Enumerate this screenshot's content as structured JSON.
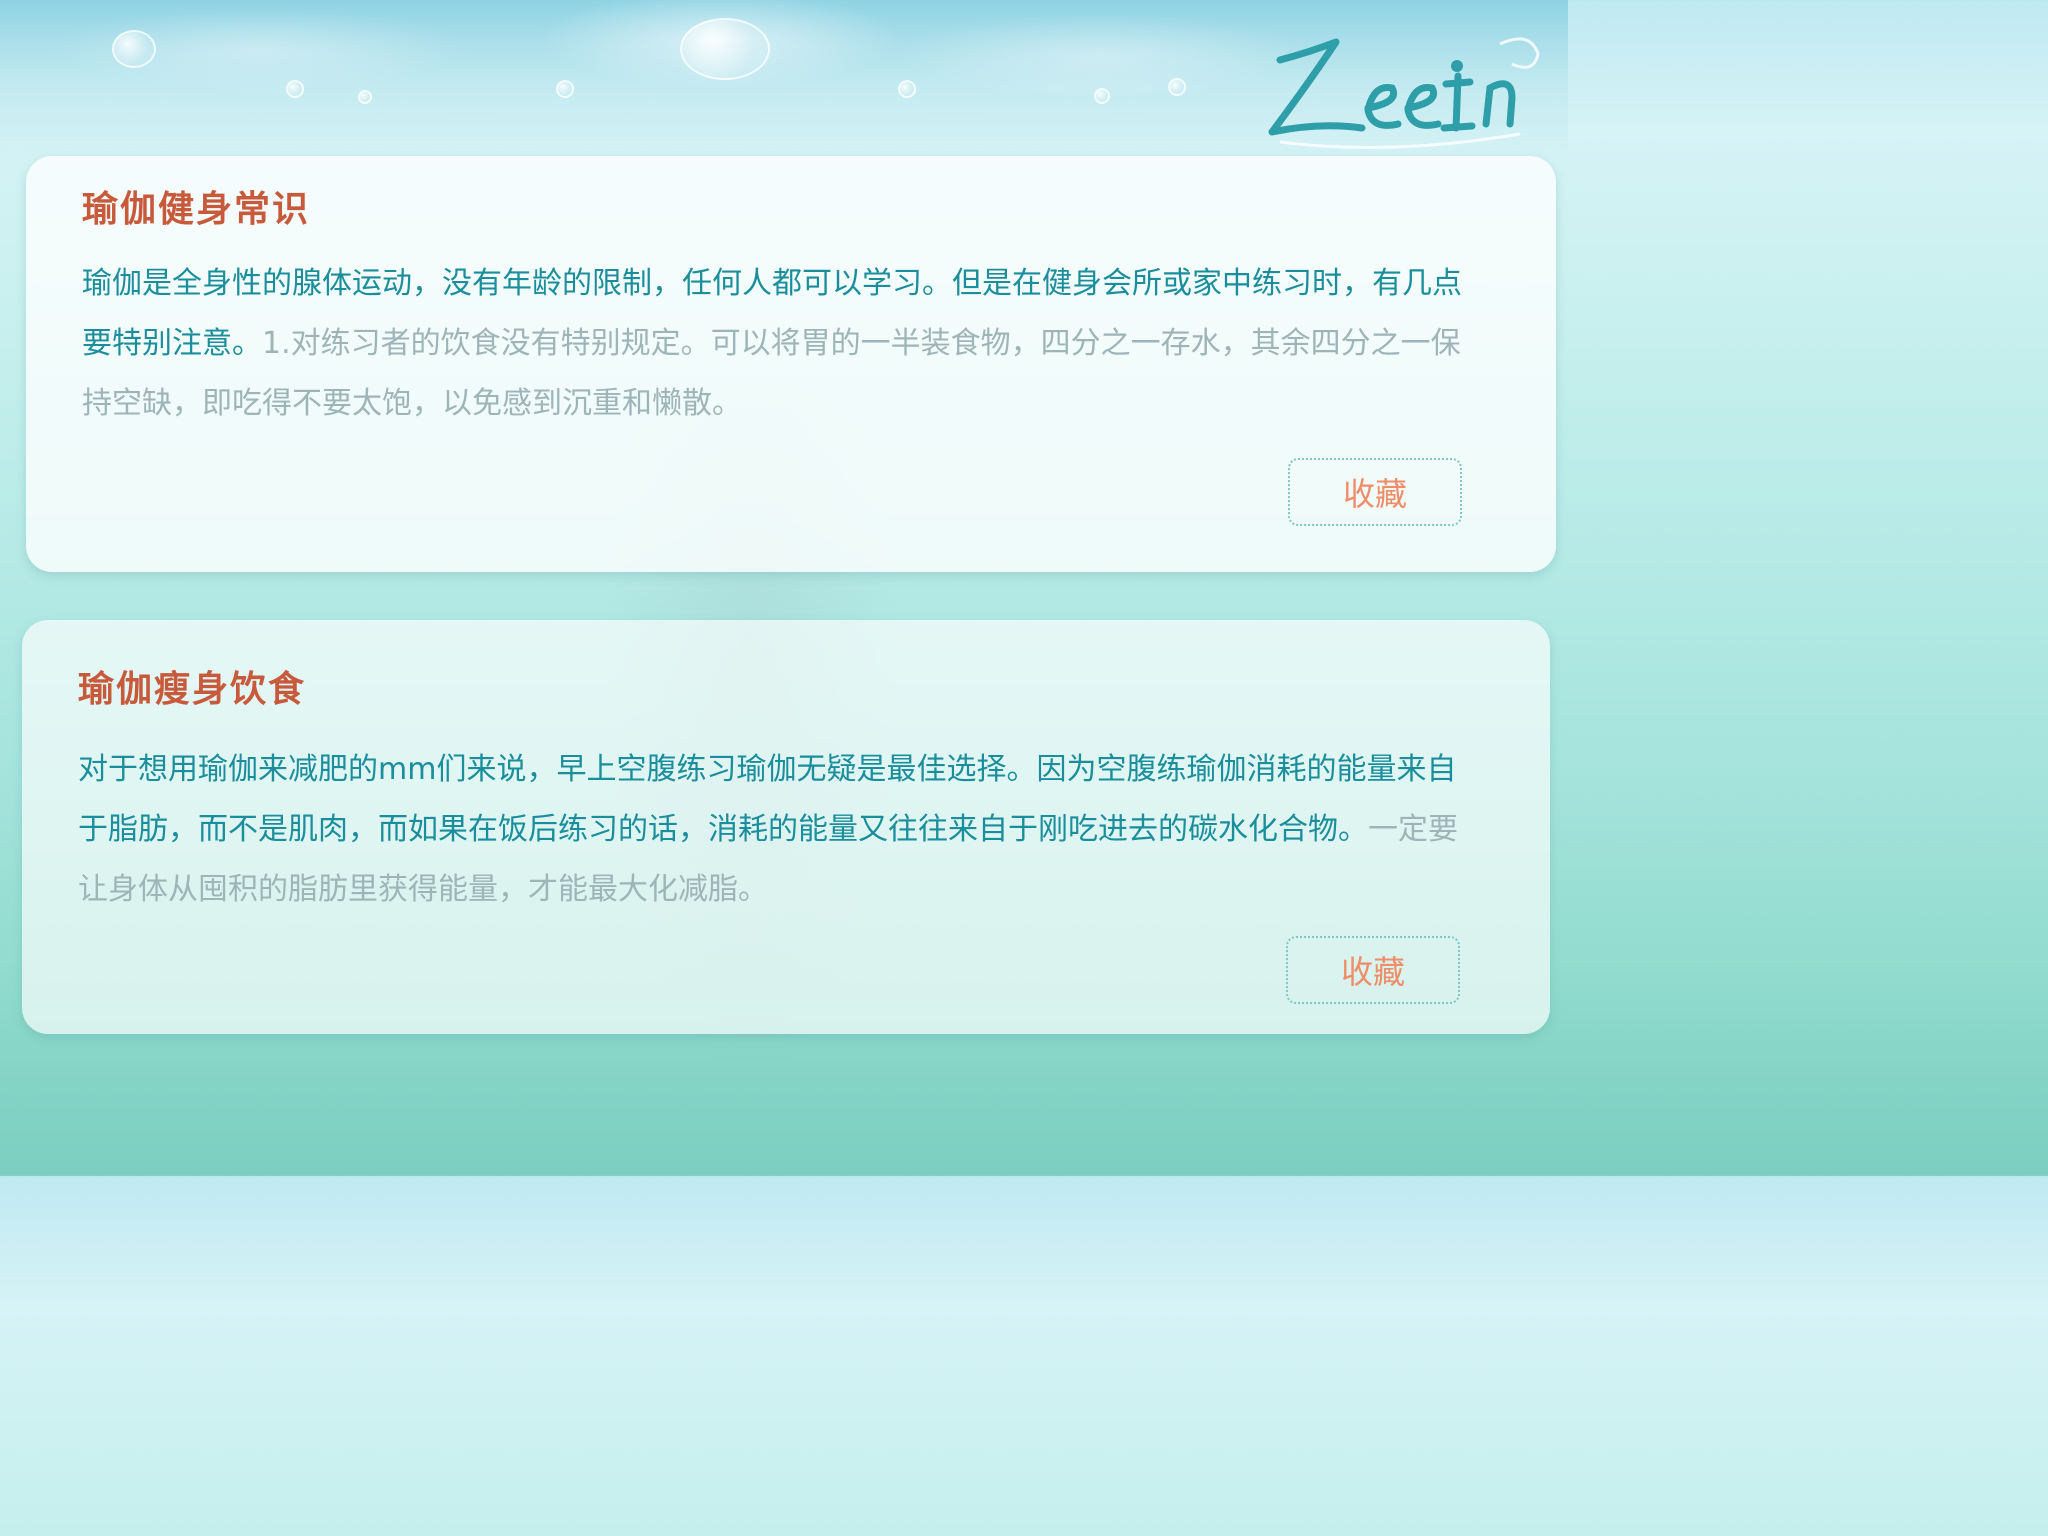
{
  "logo": {
    "text": "Zeein"
  },
  "cards": [
    {
      "title": "瑜伽健身常识",
      "body_strong": "瑜伽是全身性的腺体运动，没有年龄的限制，任何人都可以学习。但是在健身会所或家中练习时，有几点要特别注意。",
      "body_faded": "1.对练习者的饮食没有特别规定。可以将胃的一半装食物，四分之一存水，其余四分之一保持空缺，即吃得不要太饱，以免感到沉重和懒散。",
      "button_label": "收藏"
    },
    {
      "title": "瑜伽瘦身饮食",
      "body_strong": "对于想用瑜伽来减肥的mm们来说，早上空腹练习瑜伽无疑是最佳选择。因为空腹练瑜伽消耗的能量来自于脂肪，而不是肌肉，而如果在饭后练习的话，消耗的能量又往往来自于刚吃进去的碳水化合物。",
      "body_faded": "一定要让身体从囤积的脂肪里获得能量，才能最大化减脂。",
      "button_label": "收藏"
    }
  ],
  "colors": {
    "title": "#c85a3c",
    "text_strong": "#1a8e9c",
    "text_faded": "#9db4b8",
    "button_text": "#ef8d68",
    "button_border": "#7ec6cc"
  }
}
